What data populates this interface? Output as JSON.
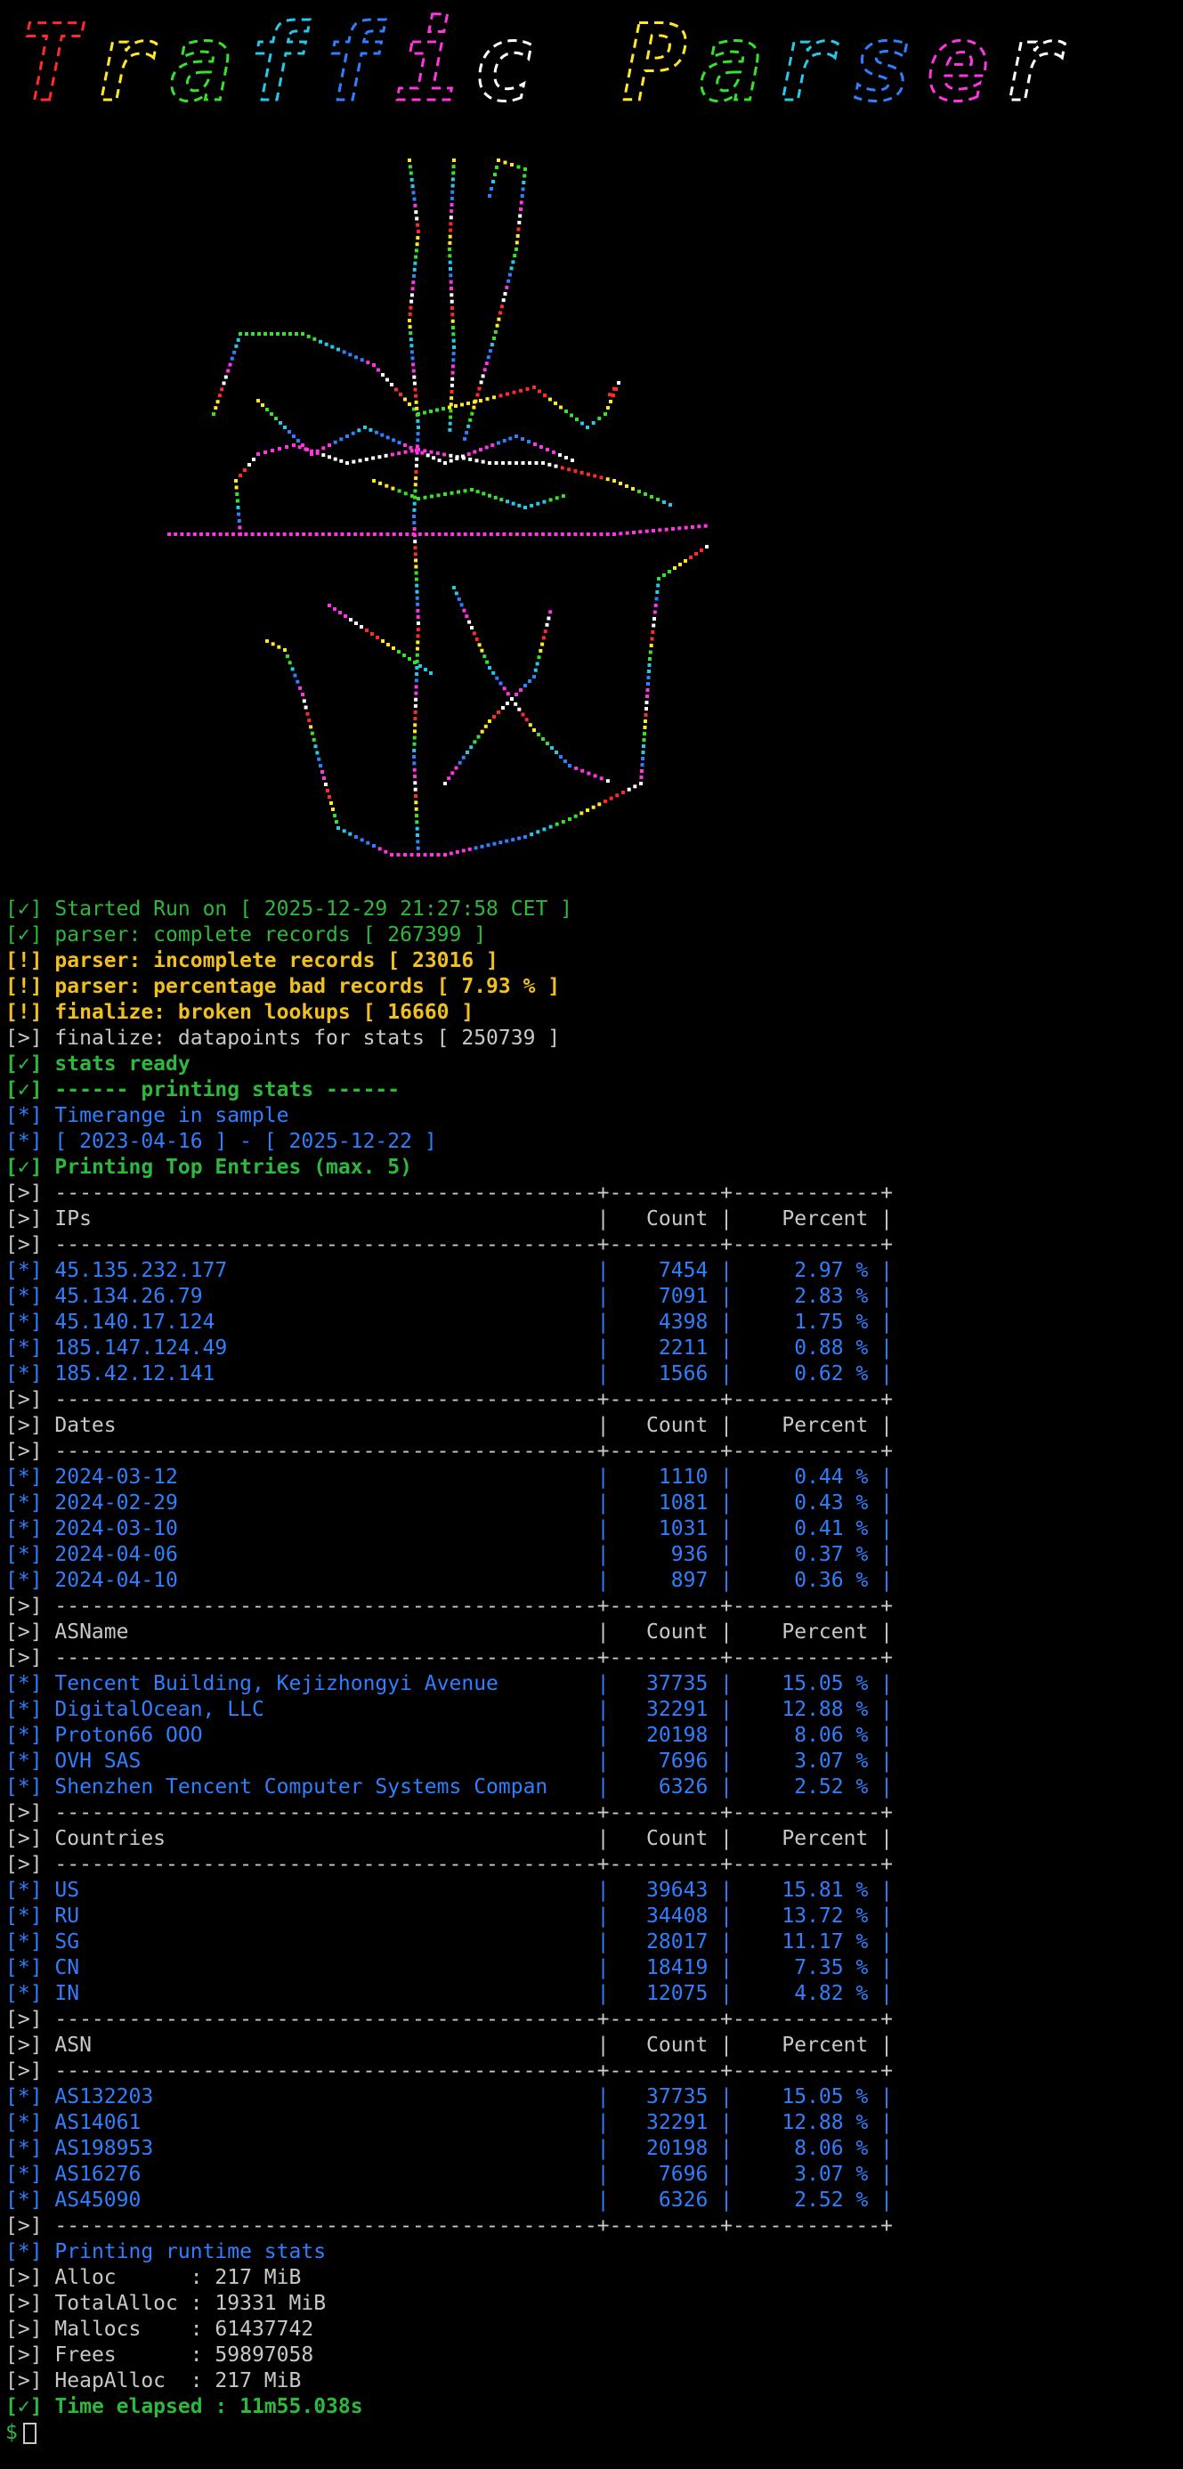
{
  "banner": {
    "title_text": "Traffic Parser",
    "glyph_colors": [
      "#ff2b2b",
      "#ffe629",
      "#38e02e",
      "#29c7e8",
      "#2f7fff",
      "#ff35e0",
      "#ffffff"
    ]
  },
  "artwork": {
    "description_icon": "noodle-takeout-box-with-chopsticks",
    "dot_colors": [
      "#ff2b2b",
      "#ffe629",
      "#38e02e",
      "#29c7e8",
      "#2f7fff",
      "#ff35e0",
      "#ffffff"
    ]
  },
  "status_lines": [
    {
      "prefix": "[✓]",
      "text": "Started Run on [ 2025-12-29 21:27:58 CET ]",
      "style": "green"
    },
    {
      "prefix": "[✓]",
      "text": "parser: complete records [ 267399 ]",
      "style": "green"
    },
    {
      "prefix": "[!]",
      "text": "parser: incomplete records [ 23016 ]",
      "style": "yellow"
    },
    {
      "prefix": "[!]",
      "text": "parser: percentage bad records [ 7.93 % ]",
      "style": "yellow"
    },
    {
      "prefix": "[!]",
      "text": "finalize: broken lookups [ 16660 ]",
      "style": "yellow"
    },
    {
      "prefix": "[>]",
      "text": "finalize: datapoints for stats [ 250739 ]",
      "style": "gray"
    },
    {
      "prefix": "[✓]",
      "text": "stats ready",
      "style": "green"
    },
    {
      "prefix": "[✓]",
      "text": "------ printing stats ------",
      "style": "green"
    },
    {
      "prefix": "[*]",
      "text": "Timerange in sample",
      "style": "blue"
    },
    {
      "prefix": "[*]",
      "text": "[ 2023-04-16 ] - [ 2025-12-22 ]",
      "style": "blue"
    },
    {
      "prefix": "[✓]",
      "text": "Printing Top Entries (max. 5)",
      "style": "green"
    }
  ],
  "tables": [
    {
      "header": "IPs",
      "count_label": "Count",
      "percent_label": "Percent",
      "rows": [
        {
          "name": "45.135.232.177",
          "count": "7454",
          "percent": "2.97 %"
        },
        {
          "name": "45.134.26.79",
          "count": "7091",
          "percent": "2.83 %"
        },
        {
          "name": "45.140.17.124",
          "count": "4398",
          "percent": "1.75 %"
        },
        {
          "name": "185.147.124.49",
          "count": "2211",
          "percent": "0.88 %"
        },
        {
          "name": "185.42.12.141",
          "count": "1566",
          "percent": "0.62 %"
        }
      ]
    },
    {
      "header": "Dates",
      "count_label": "Count",
      "percent_label": "Percent",
      "rows": [
        {
          "name": "2024-03-12",
          "count": "1110",
          "percent": "0.44 %"
        },
        {
          "name": "2024-02-29",
          "count": "1081",
          "percent": "0.43 %"
        },
        {
          "name": "2024-03-10",
          "count": "1031",
          "percent": "0.41 %"
        },
        {
          "name": "2024-04-06",
          "count": "936",
          "percent": "0.37 %"
        },
        {
          "name": "2024-04-10",
          "count": "897",
          "percent": "0.36 %"
        }
      ]
    },
    {
      "header": "ASName",
      "count_label": "Count",
      "percent_label": "Percent",
      "rows": [
        {
          "name": "Tencent Building, Kejizhongyi Avenue",
          "count": "37735",
          "percent": "15.05 %"
        },
        {
          "name": "DigitalOcean, LLC",
          "count": "32291",
          "percent": "12.88 %"
        },
        {
          "name": "Proton66 OOO",
          "count": "20198",
          "percent": "8.06 %"
        },
        {
          "name": "OVH SAS",
          "count": "7696",
          "percent": "3.07 %"
        },
        {
          "name": "Shenzhen Tencent Computer Systems Compan",
          "count": "6326",
          "percent": "2.52 %"
        }
      ]
    },
    {
      "header": "Countries",
      "count_label": "Count",
      "percent_label": "Percent",
      "rows": [
        {
          "name": "US",
          "count": "39643",
          "percent": "15.81 %"
        },
        {
          "name": "RU",
          "count": "34408",
          "percent": "13.72 %"
        },
        {
          "name": "SG",
          "count": "28017",
          "percent": "11.17 %"
        },
        {
          "name": "CN",
          "count": "18419",
          "percent": "7.35 %"
        },
        {
          "name": "IN",
          "count": "12075",
          "percent": "4.82 %"
        }
      ]
    },
    {
      "header": "ASN",
      "count_label": "Count",
      "percent_label": "Percent",
      "rows": [
        {
          "name": "AS132203",
          "count": "37735",
          "percent": "15.05 %"
        },
        {
          "name": "AS14061",
          "count": "32291",
          "percent": "12.88 %"
        },
        {
          "name": "AS198953",
          "count": "20198",
          "percent": "8.06 %"
        },
        {
          "name": "AS16276",
          "count": "7696",
          "percent": "3.07 %"
        },
        {
          "name": "AS45090",
          "count": "6326",
          "percent": "2.52 %"
        }
      ]
    }
  ],
  "table_prefixes": {
    "separator": "[>]",
    "header": "[>]",
    "row": "[*]"
  },
  "runtime": {
    "heading": {
      "prefix": "[*]",
      "text": "Printing runtime stats"
    },
    "lines": [
      {
        "prefix": "[>]",
        "text": "Alloc      : 217 MiB"
      },
      {
        "prefix": "[>]",
        "text": "TotalAlloc : 19331 MiB"
      },
      {
        "prefix": "[>]",
        "text": "Mallocs    : 61437742"
      },
      {
        "prefix": "[>]",
        "text": "Frees      : 59897058"
      },
      {
        "prefix": "[>]",
        "text": "HeapAlloc  : 217 MiB"
      }
    ],
    "elapsed": {
      "prefix": "[✓]",
      "text": "Time elapsed : 11m55.038s"
    }
  },
  "prompt": {
    "symbol": "$"
  },
  "colors": {
    "green": "#2eb83c",
    "yellow": "#f2c01e",
    "gray": "#c8c8c8",
    "blue": "#2f7fff",
    "background": "#000000"
  }
}
